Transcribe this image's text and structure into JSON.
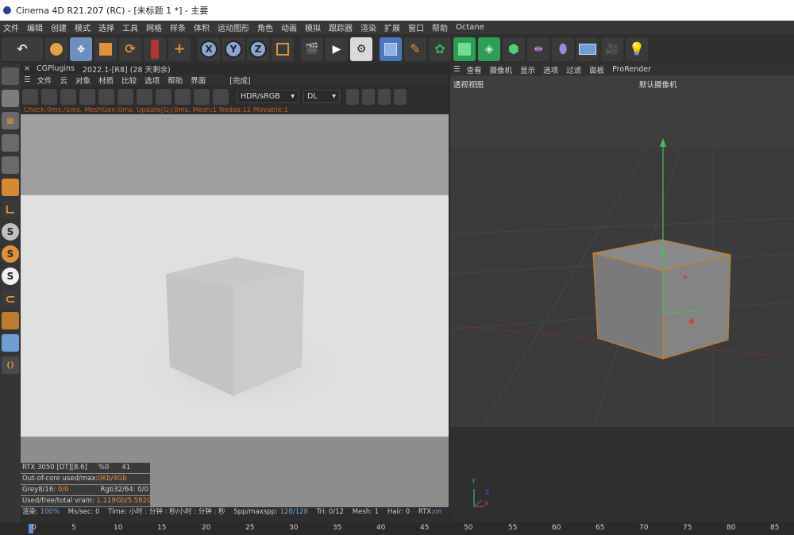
{
  "window": {
    "title": "Cinema 4D R21.207 (RC) - [未标题 1 *] - 主要"
  },
  "menubar": {
    "items": [
      "文件",
      "编辑",
      "创建",
      "模式",
      "选择",
      "工具",
      "网格",
      "样条",
      "体积",
      "运动图形",
      "角色",
      "动画",
      "模拟",
      "跟踪器",
      "渲染",
      "扩展",
      "窗口",
      "帮助",
      "Octane"
    ]
  },
  "toolbar": {
    "icons": [
      "undo-icon",
      "select-icon",
      "move-icon",
      "scale-icon",
      "rotate-icon",
      "live-selection-icon",
      "add-icon",
      "x-axis-icon",
      "y-axis-icon",
      "z-axis-icon",
      "coordinate-icon",
      "render-region-icon",
      "render-view-icon",
      "render-settings-icon",
      "cube-icon",
      "pen-icon",
      "bug-icon",
      "subdivision-icon",
      "array-icon",
      "cloner-icon",
      "symmetry-icon",
      "deformer-icon",
      "floor-icon",
      "camera-icon",
      "light-icon"
    ],
    "axis_labels": {
      "x": "X",
      "y": "Y",
      "z": "Z"
    }
  },
  "renderer": {
    "tab_close": "×",
    "tab_title": "CGPlugins",
    "tab_version": "2022.1-[R8] (28 天剩余)",
    "menu": [
      "文件",
      "云",
      "对象",
      "材质",
      "比较",
      "选项",
      "帮助",
      "界面"
    ],
    "status_done": "[完成]",
    "hdr_select": "HDR/sRGB",
    "dl_select": "DL",
    "status_line": "Check:0ms./1ms. MeshGen:0ms. Update[G]:0ms. Mesh:1 Nodes:12 Movable:1",
    "stats": {
      "gpu": "RTX 3050 [DT][8.6]",
      "percent": "%0",
      "temp": "41",
      "outofcore_label": "Out-of-core used/max:",
      "outofcore_val": "0Kb/4Gb",
      "grey_label": "Grey8/16: ",
      "grey_val": "0/0",
      "rgb": "Rgb32/64: 0/0",
      "vram_label": "Used/free/total vram: ",
      "vram_val": "1.119Gb/5.582Gb/7.9"
    },
    "bottom": {
      "render_label": "渲染: ",
      "render_val": "100%",
      "ms_label": "Ms/sec: 0",
      "time_label": "Time: 小时 : 分钟 : 秒/小时 : 分钟 : 秒",
      "spp_label": "Spp/maxspp: ",
      "spp_val": "128/128",
      "tri_label": "Tri: 0/12",
      "mesh_label": "Mesh: 1",
      "hair_label": "Hair: 0",
      "rtx_label": "RTX:",
      "rtx_val": "on"
    }
  },
  "viewport": {
    "menu": [
      "查看",
      "摄像机",
      "显示",
      "选项",
      "过滤",
      "面板",
      "ProRender"
    ],
    "view_name": "透视视图",
    "camera_name": "默认摄像机",
    "axis_labels": {
      "y": "Y",
      "z": "Z",
      "x": "X"
    }
  },
  "timeline": {
    "ticks": [
      "0",
      "5",
      "10",
      "15",
      "20",
      "25",
      "30",
      "35",
      "40",
      "45",
      "50",
      "55",
      "60",
      "65",
      "70",
      "75",
      "80",
      "85"
    ]
  },
  "colors": {
    "accent": "#e39038",
    "selection": "#5a8ed6",
    "selected_edge": "#d07a25"
  }
}
